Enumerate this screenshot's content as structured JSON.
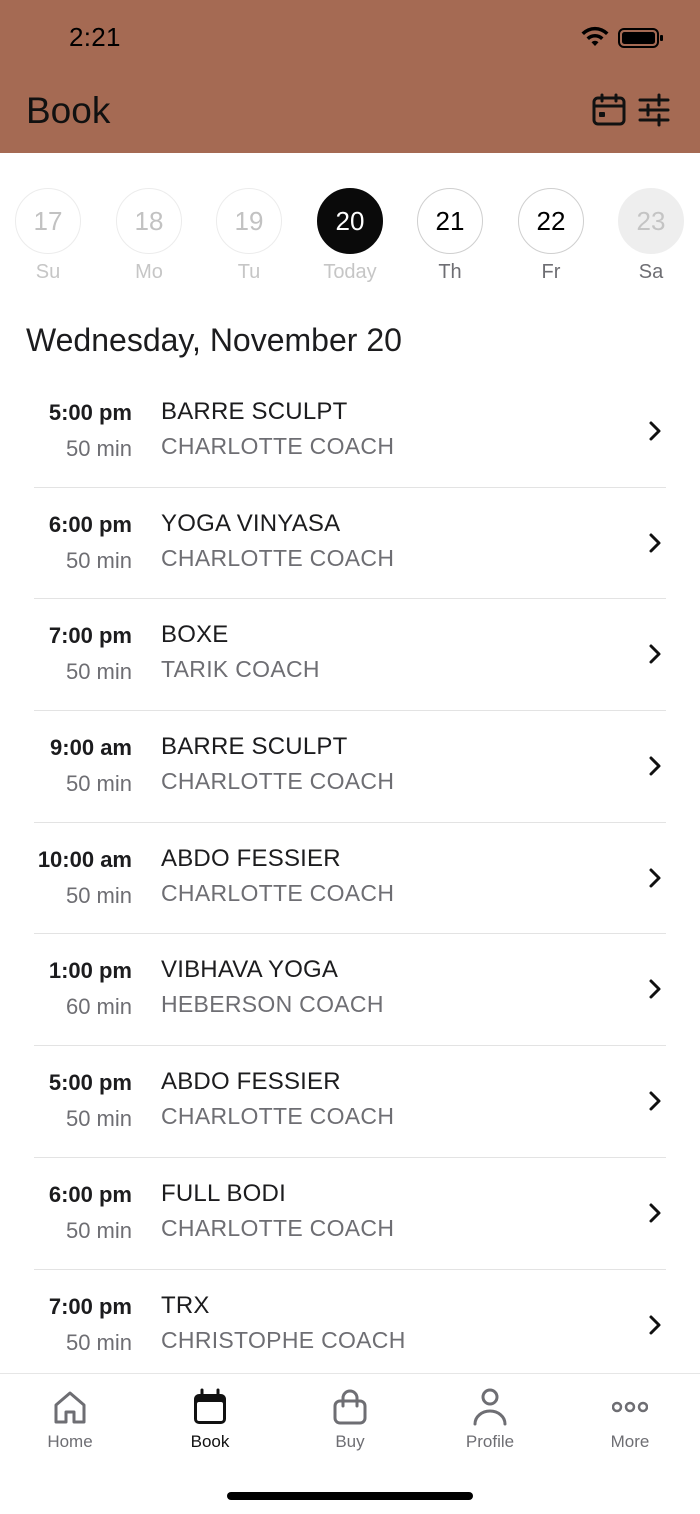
{
  "status_bar": {
    "time": "2:21"
  },
  "header": {
    "title": "Book",
    "background": "#a56a53"
  },
  "day_strip": [
    {
      "number": "17",
      "label": "Su",
      "state": "past"
    },
    {
      "number": "18",
      "label": "Mo",
      "state": "past"
    },
    {
      "number": "19",
      "label": "Tu",
      "state": "past"
    },
    {
      "number": "20",
      "label": "Today",
      "state": "selected"
    },
    {
      "number": "21",
      "label": "Th",
      "state": "future"
    },
    {
      "number": "22",
      "label": "Fr",
      "state": "future"
    },
    {
      "number": "23",
      "label": "Sa",
      "state": "disabled"
    }
  ],
  "date_heading": "Wednesday, November 20",
  "classes": [
    {
      "time": "5:00 pm",
      "duration": "50 min",
      "name": "BARRE SCULPT",
      "coach": "CHARLOTTE COACH"
    },
    {
      "time": "6:00 pm",
      "duration": "50 min",
      "name": "YOGA VINYASA",
      "coach": "CHARLOTTE COACH"
    },
    {
      "time": "7:00 pm",
      "duration": "50 min",
      "name": "BOXE",
      "coach": "TARIK COACH"
    },
    {
      "time": "9:00 am",
      "duration": "50 min",
      "name": "BARRE SCULPT",
      "coach": "CHARLOTTE COACH"
    },
    {
      "time": "10:00 am",
      "duration": "50 min",
      "name": "ABDO FESSIER",
      "coach": "CHARLOTTE COACH"
    },
    {
      "time": "1:00 pm",
      "duration": "60 min",
      "name": "VIBHAVA YOGA",
      "coach": "HEBERSON COACH"
    },
    {
      "time": "5:00 pm",
      "duration": "50 min",
      "name": "ABDO FESSIER",
      "coach": "CHARLOTTE COACH"
    },
    {
      "time": "6:00 pm",
      "duration": "50 min",
      "name": "FULL BODI",
      "coach": "CHARLOTTE COACH"
    },
    {
      "time": "7:00 pm",
      "duration": "50 min",
      "name": "TRX",
      "coach": "CHRISTOPHE COACH"
    }
  ],
  "tab_bar": {
    "tabs": [
      {
        "label": "Home",
        "icon": "home-icon",
        "active": false
      },
      {
        "label": "Book",
        "icon": "calendar-icon",
        "active": true
      },
      {
        "label": "Buy",
        "icon": "shopping-bag-icon",
        "active": false
      },
      {
        "label": "Profile",
        "icon": "person-icon",
        "active": false
      },
      {
        "label": "More",
        "icon": "more-dots-icon",
        "active": false
      }
    ]
  }
}
